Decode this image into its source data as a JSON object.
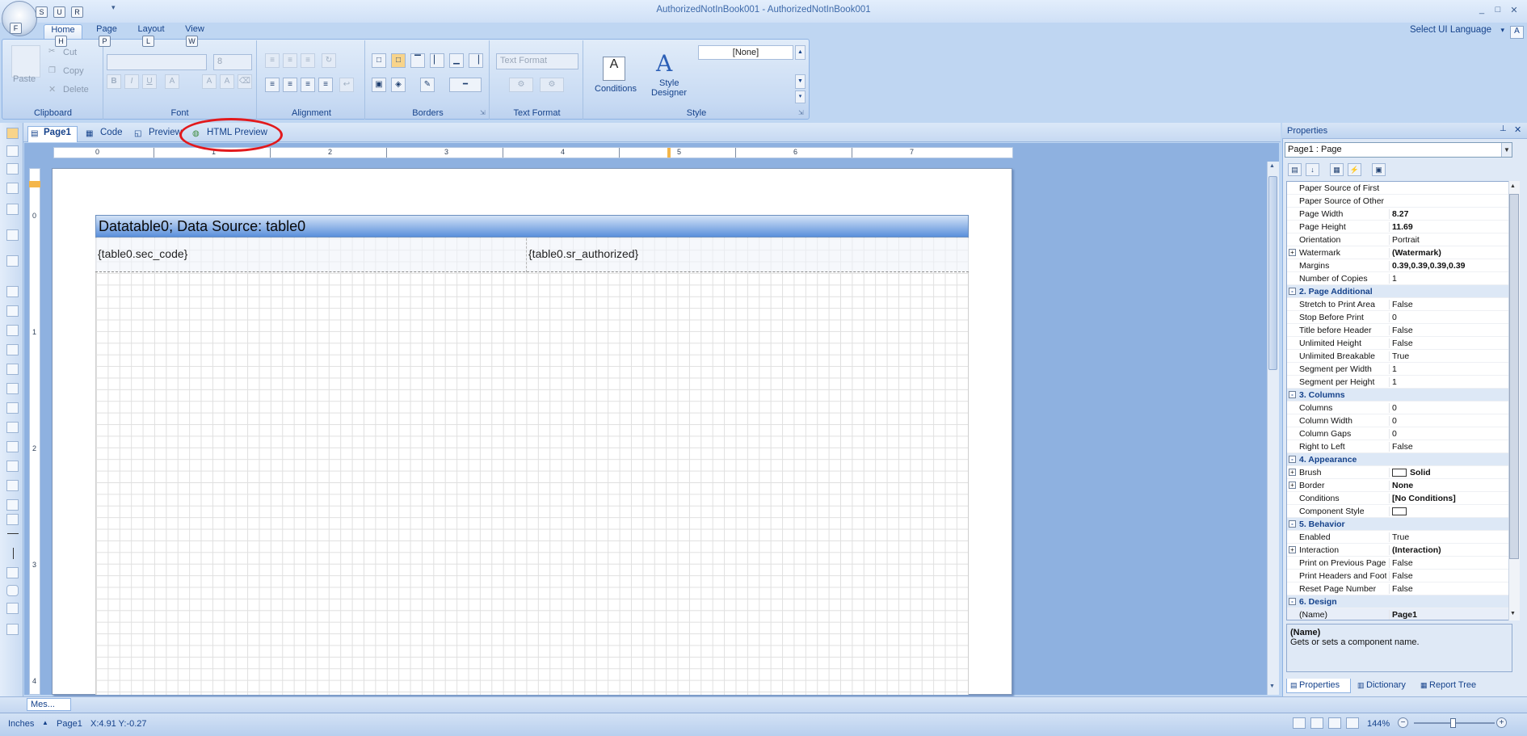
{
  "window": {
    "title": "AuthorizedNotInBook001 - AuthorizedNotInBook001",
    "controls": [
      "_",
      "□",
      "✕"
    ]
  },
  "quick_access": {
    "keytips": [
      "S",
      "U",
      "R",
      "F"
    ]
  },
  "ribbon_tabs": [
    {
      "label": "Home",
      "keytip": "H",
      "active": true
    },
    {
      "label": "Page",
      "keytip": "P"
    },
    {
      "label": "Layout",
      "keytip": "L"
    },
    {
      "label": "View",
      "keytip": "W"
    }
  ],
  "ui_language": {
    "label": "Select UI Language",
    "keytip": "A"
  },
  "ribbon": {
    "clipboard": {
      "label": "Clipboard",
      "paste": "Paste",
      "cut": "Cut",
      "copy": "Copy",
      "delete": "Delete"
    },
    "font": {
      "label": "Font",
      "size": "8",
      "bold": "B",
      "italic": "I",
      "underline": "U"
    },
    "alignment": {
      "label": "Alignment"
    },
    "borders": {
      "label": "Borders"
    },
    "text_format": {
      "label": "Text Format",
      "combo": "Text Format"
    },
    "style": {
      "label": "Style",
      "conditions": "Conditions",
      "style_designer_1": "Style",
      "style_designer_2": "Designer",
      "style_combo": "[None]"
    }
  },
  "doc_tabs": [
    {
      "label": "Page1",
      "active": true
    },
    {
      "label": "Code"
    },
    {
      "label": "Preview"
    },
    {
      "label": "HTML Preview",
      "highlighted": true
    }
  ],
  "ruler": {
    "h_numbers": [
      "0",
      "1",
      "2",
      "3",
      "4",
      "5",
      "6",
      "7"
    ],
    "v_numbers": [
      "0",
      "1",
      "2",
      "3",
      "4"
    ]
  },
  "report": {
    "header_band": "Datatable0; Data Source: table0",
    "fields": [
      "{table0.sec_code}",
      "{table0.sr_authorized}"
    ]
  },
  "properties": {
    "title": "Properties",
    "selected": "Page1 : Page",
    "rows": [
      {
        "type": "prop",
        "name": "Paper Source of First",
        "value": ""
      },
      {
        "type": "prop",
        "name": "Paper Source of Other",
        "value": ""
      },
      {
        "type": "prop",
        "name": "Page Width",
        "value": "8.27",
        "bold": true
      },
      {
        "type": "prop",
        "name": "Page Height",
        "value": "11.69",
        "bold": true
      },
      {
        "type": "prop",
        "name": "Orientation",
        "value": "Portrait"
      },
      {
        "type": "prop",
        "name": "Watermark",
        "value": "(Watermark)",
        "bold": true,
        "expand": "+"
      },
      {
        "type": "prop",
        "name": "Margins",
        "value": "0.39,0.39,0.39,0.39",
        "bold": true
      },
      {
        "type": "prop",
        "name": "Number of Copies",
        "value": "1"
      },
      {
        "type": "cat",
        "name": "2. Page  Additional",
        "expand": "-"
      },
      {
        "type": "prop",
        "name": "Stretch to Print Area",
        "value": "False"
      },
      {
        "type": "prop",
        "name": "Stop Before Print",
        "value": "0"
      },
      {
        "type": "prop",
        "name": "Title before Header",
        "value": "False"
      },
      {
        "type": "prop",
        "name": "Unlimited Height",
        "value": "False"
      },
      {
        "type": "prop",
        "name": "Unlimited Breakable",
        "value": "True"
      },
      {
        "type": "prop",
        "name": "Segment per Width",
        "value": "1"
      },
      {
        "type": "prop",
        "name": "Segment per Height",
        "value": "1"
      },
      {
        "type": "cat",
        "name": "3. Columns",
        "expand": "-"
      },
      {
        "type": "prop",
        "name": "Columns",
        "value": "0"
      },
      {
        "type": "prop",
        "name": "Column Width",
        "value": "0"
      },
      {
        "type": "prop",
        "name": "Column Gaps",
        "value": "0"
      },
      {
        "type": "prop",
        "name": "Right to Left",
        "value": "False"
      },
      {
        "type": "cat",
        "name": "4. Appearance",
        "expand": "-"
      },
      {
        "type": "prop",
        "name": "Brush",
        "value": "Solid",
        "bold": true,
        "expand": "+",
        "swatch": true
      },
      {
        "type": "prop",
        "name": "Border",
        "value": "None",
        "bold": true,
        "expand": "+"
      },
      {
        "type": "prop",
        "name": "Conditions",
        "value": "[No Conditions]",
        "bold": true
      },
      {
        "type": "prop",
        "name": "Component Style",
        "value": "",
        "swatch": true
      },
      {
        "type": "cat",
        "name": "5. Behavior",
        "expand": "-"
      },
      {
        "type": "prop",
        "name": "Enabled",
        "value": "True"
      },
      {
        "type": "prop",
        "name": "Interaction",
        "value": "(Interaction)",
        "bold": true,
        "expand": "+"
      },
      {
        "type": "prop",
        "name": "Print on Previous Page",
        "value": "False"
      },
      {
        "type": "prop",
        "name": "Print Headers and Footers",
        "value": "False"
      },
      {
        "type": "prop",
        "name": "Reset Page Number",
        "value": "False"
      },
      {
        "type": "cat",
        "name": "6. Design",
        "expand": "-"
      },
      {
        "type": "prop",
        "name": "(Name)",
        "value": "Page1",
        "bold": true
      }
    ],
    "description_title": "(Name)",
    "description_text": "Gets or sets a component name.",
    "bottom_tabs": [
      "Properties",
      "Dictionary",
      "Report Tree"
    ]
  },
  "messages_tab": "Mes...",
  "status": {
    "units": "Inches",
    "page": "Page1",
    "coords": "X:4.91  Y:-0.27",
    "zoom": "144%"
  },
  "colors": {
    "accent": "#15428b",
    "highlight_ellipse": "#e2191c",
    "band_header": "#5a8fdb"
  }
}
